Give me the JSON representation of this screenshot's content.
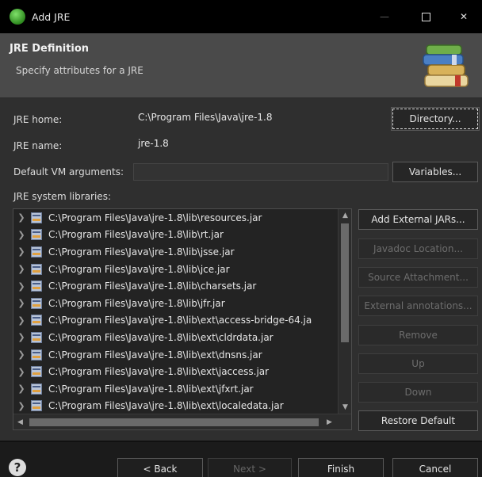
{
  "window": {
    "title": "Add JRE"
  },
  "header": {
    "title": "JRE Definition",
    "subtitle": "Specify attributes for a JRE",
    "icon": "library-books-icon"
  },
  "form": {
    "jre_home_label": "JRE home:",
    "jre_home_value": "C:\\Program Files\\Java\\jre-1.8",
    "jre_name_label": "JRE name:",
    "jre_name_value": "jre-1.8",
    "vm_args_label": "Default VM arguments:",
    "vm_args_value": "",
    "libs_label": "JRE system libraries:"
  },
  "buttons": {
    "directory": "Directory...",
    "variables": "Variables...",
    "add_external_jars": "Add External JARs...",
    "javadoc_location": "Javadoc Location...",
    "source_attachment": "Source Attachment...",
    "external_annotations": "External annotations...",
    "remove": "Remove",
    "up": "Up",
    "down": "Down",
    "restore_default": "Restore Default"
  },
  "libraries": [
    "C:\\Program Files\\Java\\jre-1.8\\lib\\resources.jar",
    "C:\\Program Files\\Java\\jre-1.8\\lib\\rt.jar",
    "C:\\Program Files\\Java\\jre-1.8\\lib\\jsse.jar",
    "C:\\Program Files\\Java\\jre-1.8\\lib\\jce.jar",
    "C:\\Program Files\\Java\\jre-1.8\\lib\\charsets.jar",
    "C:\\Program Files\\Java\\jre-1.8\\lib\\jfr.jar",
    "C:\\Program Files\\Java\\jre-1.8\\lib\\ext\\access-bridge-64.ja",
    "C:\\Program Files\\Java\\jre-1.8\\lib\\ext\\cldrdata.jar",
    "C:\\Program Files\\Java\\jre-1.8\\lib\\ext\\dnsns.jar",
    "C:\\Program Files\\Java\\jre-1.8\\lib\\ext\\jaccess.jar",
    "C:\\Program Files\\Java\\jre-1.8\\lib\\ext\\jfxrt.jar",
    "C:\\Program Files\\Java\\jre-1.8\\lib\\ext\\localedata.jar"
  ],
  "footer": {
    "help": "?",
    "back": "< Back",
    "next": "Next >",
    "finish": "Finish",
    "cancel": "Cancel"
  },
  "colors": {
    "titlebar": "#000000",
    "header": "#4a4a4a",
    "panel": "#2f2f2f",
    "list": "#232323"
  }
}
